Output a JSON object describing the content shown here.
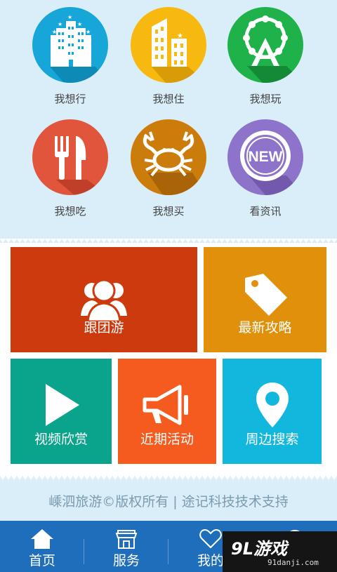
{
  "categories": [
    {
      "label": "我想行",
      "color": "#16a7d8",
      "icon": "hotel-building-icon"
    },
    {
      "label": "我想住",
      "color": "#f7b80f",
      "icon": "apartment-buildings-icon"
    },
    {
      "label": "我想玩",
      "color": "#1fb14a",
      "icon": "ferris-wheel-icon"
    },
    {
      "label": "我想吃",
      "color": "#e0553b",
      "icon": "fork-knife-icon"
    },
    {
      "label": "我想买",
      "color": "#cc7c0b",
      "icon": "crab-icon"
    },
    {
      "label": "看资讯",
      "color": "#8d73c9",
      "icon": "new-badge-icon",
      "badge_text": "NEW"
    }
  ],
  "tiles": [
    {
      "label": "跟团游",
      "color": "#cc3a0e",
      "icon": "group-people-icon"
    },
    {
      "label": "最新攻略",
      "color": "#e0900a",
      "icon": "price-tag-icon"
    },
    {
      "label": "视频欣赏",
      "color": "#0aa48c",
      "icon": "play-icon"
    },
    {
      "label": "近期活动",
      "color": "#f55a1e",
      "icon": "megaphone-icon"
    },
    {
      "label": "周边搜索",
      "color": "#11b7dd",
      "icon": "location-pin-icon"
    }
  ],
  "footer": {
    "copyright": "嵊泗旅游©版权所有 | 途记科技技术支持"
  },
  "tabbar": {
    "bg": "#1e6ebc",
    "items": [
      {
        "label": "首页",
        "icon": "home-icon"
      },
      {
        "label": "服务",
        "icon": "shop-icon"
      },
      {
        "label": "我的",
        "icon": "heart-icon"
      },
      {
        "label": "",
        "icon": "more-icon"
      }
    ]
  },
  "watermark": {
    "logo": "9L游戏",
    "url": "91danji.com"
  }
}
